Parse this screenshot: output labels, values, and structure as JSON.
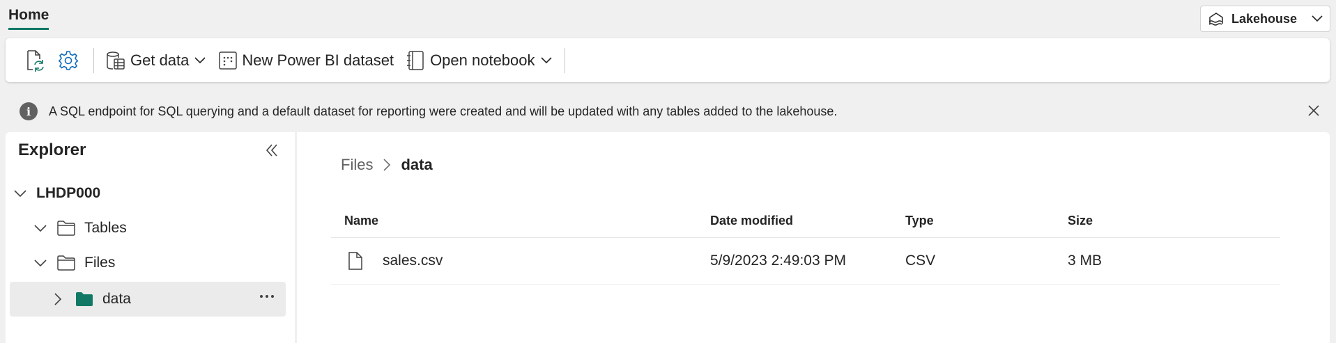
{
  "header": {
    "tab_label": "Home",
    "mode_label": "Lakehouse"
  },
  "ribbon": {
    "get_data_label": "Get data",
    "new_dataset_label": "New Power BI dataset",
    "open_notebook_label": "Open notebook"
  },
  "infobar": {
    "message": "A SQL endpoint for SQL querying and a default dataset for reporting were created and will be updated with any tables added to the lakehouse."
  },
  "explorer": {
    "title": "Explorer",
    "tree": {
      "root_label": "LHDP000",
      "tables_label": "Tables",
      "files_label": "Files",
      "data_label": "data"
    }
  },
  "content": {
    "breadcrumb": {
      "parent": "Files",
      "current": "data"
    },
    "columns": {
      "name": "Name",
      "date_modified": "Date modified",
      "type": "Type",
      "size": "Size"
    },
    "rows": [
      {
        "name": "sales.csv",
        "date_modified": "5/9/2023 2:49:03 PM",
        "type": "CSV",
        "size": "3 MB"
      }
    ]
  },
  "colors": {
    "accent": "#117865",
    "folder_filled": "#117865",
    "icon_blue": "#0f6cbd"
  }
}
